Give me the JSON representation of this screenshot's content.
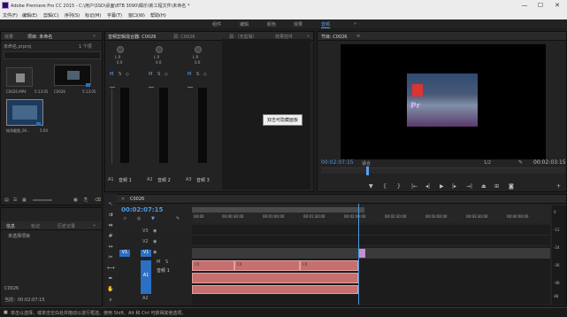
{
  "window": {
    "title": "Adobe Premiere Pro CC 2015 - C:\\用户\\SSD\\桌面\\8TB 3090\\橘乐\\新工程文件\\未命名 *",
    "minimize": "—",
    "maximize": "☐",
    "close": "✕"
  },
  "menu": [
    "文件(F)",
    "编辑(E)",
    "剪辑(C)",
    "序列(S)",
    "标记(M)",
    "字幕(T)",
    "窗口(W)",
    "帮助(H)"
  ],
  "workspaces": [
    "组件",
    "编辑",
    "颜色",
    "效果",
    "音频",
    "»"
  ],
  "active_workspace": "音频",
  "project_panel": {
    "tabs": [
      "效果",
      "项目: 未命名",
      "»"
    ],
    "project_file": "未命名.prproj",
    "item_count": "1 个项",
    "items": [
      {
        "name": "C0026.MP4",
        "duration": "5:13:05"
      },
      {
        "name": "C0026",
        "duration": "5:13:05"
      },
      {
        "name": "纯净截图_00...",
        "duration": "5:00"
      }
    ]
  },
  "info_panel": {
    "tabs": [
      "信息",
      "标记",
      "历史记录",
      "»"
    ],
    "status": "未选择项目",
    "sequence": "C0026",
    "current": "当前：00:02:07:15"
  },
  "mixer": {
    "tabs": [
      "音频剪辑混合器: C0026",
      "源: C0026",
      "源:（无剪辑）",
      "效果控件",
      "»"
    ],
    "channels": [
      {
        "name": "音频 1",
        "track": "A1",
        "lr": "L  R",
        "val": "0.0"
      },
      {
        "name": "音频 2",
        "track": "A2",
        "lr": "L  R",
        "val": "0.0"
      },
      {
        "name": "音频 3",
        "track": "A3",
        "lr": "L  R",
        "val": "0.0"
      }
    ],
    "tooltip": "双击可隐藏面板"
  },
  "program_monitor": {
    "tabs": [
      "节目: C0026",
      "≡"
    ],
    "timecode": "00:02:07:15",
    "fit": "适合",
    "quality": "1/2",
    "duration": "00:02:03:15",
    "frame_letters": "Pr"
  },
  "timeline": {
    "tabs": [
      "C0026"
    ],
    "timecode": "00:02:07:15",
    "ruler": [
      "00:00",
      "00:00:30:00",
      "00:01:00:00",
      "00:01:30:00",
      "00:02:00:00",
      "00:02:30:00",
      "00:03:00:00",
      "00:03:30:00",
      "00:04:00:00"
    ],
    "tracks": [
      "V3",
      "V2",
      "V1",
      "A1",
      "A2",
      "A3"
    ],
    "a1_name": "音频 1",
    "clip_label": "C0",
    "audio_meter_scale": [
      "0",
      "-12",
      "-24",
      "-36",
      "-48",
      "dB"
    ]
  },
  "statusbar": "单击以选择，或单击空白处并拖动以进行框选。使用 Shift、Alt 和 Ctrl 可获得其他选项。",
  "colors": {
    "accent": "#5aa1f0",
    "timecode": "#4d9ce0",
    "audio_clip": "#c76e6e",
    "video_clip": "#c090d0",
    "track_target": "#2b70c2"
  }
}
